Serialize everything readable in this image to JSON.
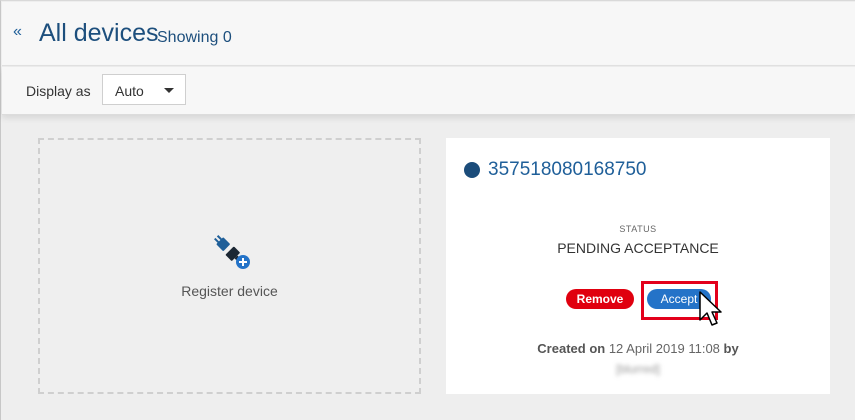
{
  "header": {
    "back_icon": "«",
    "title": "All devices",
    "count_label": "Showing 0"
  },
  "toolbar": {
    "display_label": "Display as",
    "display_value": "Auto"
  },
  "register_card": {
    "label": "Register device",
    "icon": "plug-plus-icon"
  },
  "device": {
    "id": "357518080168750",
    "status_label": "STATUS",
    "status_value": "PENDING ACCEPTANCE",
    "remove_label": "Remove",
    "accept_label": "Accept",
    "created_prefix": "Created on",
    "created_date": "12 April 2019 11:08",
    "created_by_word": "by",
    "created_by_user": "[blurred]"
  },
  "colors": {
    "accent": "#1f5f99",
    "status_dot": "#1b4c7a",
    "remove": "#e0000f",
    "accept": "#2473c8",
    "highlight": "#e3001b"
  }
}
